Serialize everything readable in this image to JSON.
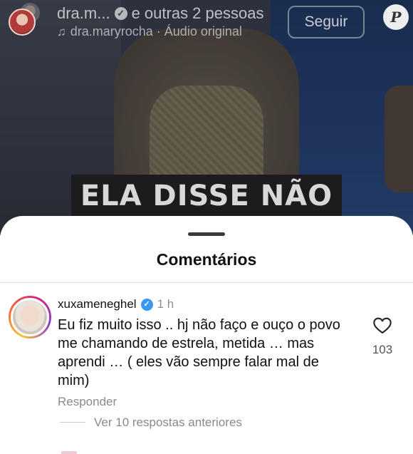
{
  "video": {
    "caption": "ELA DISSE NÃO"
  },
  "header": {
    "owner_name": "dra.m...",
    "owner_suffix": "e outras 2 pessoas",
    "verified_symbol": "✓",
    "music_icon": "music-note-icon",
    "audio_label": "dra.maryrocha · Áudio original",
    "follow_label": "Seguir",
    "badge_letter": "P"
  },
  "comments_sheet": {
    "title": "Comentários",
    "comment": {
      "username": "xuxameneghel",
      "verified": true,
      "time": "1 h",
      "text": "Eu fiz muito isso .. hj não faço e  ouço o povo me chamando de estrela, metida … mas aprendi … ( eles vão sempre falar mal de mim)",
      "likes": "103",
      "reply_label": "Responder",
      "view_replies_label": "Ver 10 respostas anteriores"
    }
  },
  "colors": {
    "verified_blue": "#3897f0",
    "muted_text": "#8a8a8a"
  }
}
